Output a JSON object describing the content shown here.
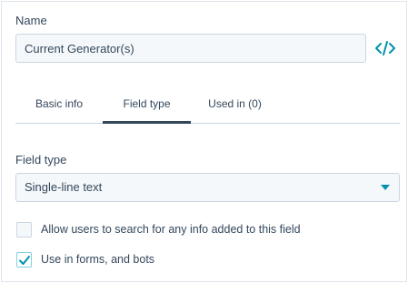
{
  "name_section": {
    "label": "Name",
    "value": "Current Generator(s)",
    "code_icon": "code-embed-icon"
  },
  "tabs": [
    {
      "label": "Basic info",
      "active": false
    },
    {
      "label": "Field type",
      "active": true
    },
    {
      "label": "Used in (0)",
      "active": false
    }
  ],
  "field_type": {
    "label": "Field type",
    "selected": "Single-line text"
  },
  "options": [
    {
      "label": "Allow users to search for any info added to this field",
      "checked": false
    },
    {
      "label": "Use in forms, and bots",
      "checked": true
    }
  ],
  "colors": {
    "text": "#33475b",
    "accent": "#0091ae",
    "input_bg": "#f5f8fa",
    "border": "#cbd6e2"
  }
}
